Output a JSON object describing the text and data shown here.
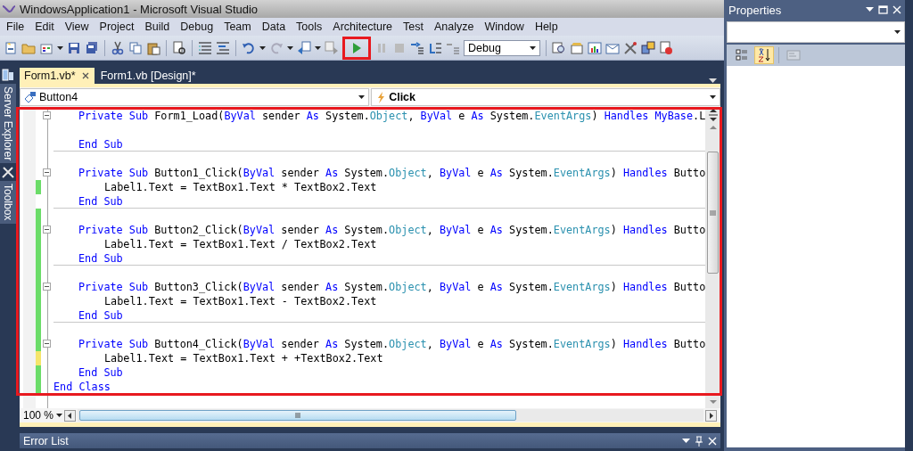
{
  "window": {
    "title": "WindowsApplication1 - Microsoft Visual Studio"
  },
  "menu": [
    "File",
    "Edit",
    "View",
    "Project",
    "Build",
    "Debug",
    "Team",
    "Data",
    "Tools",
    "Architecture",
    "Test",
    "Analyze",
    "Window",
    "Help"
  ],
  "toolbar": {
    "run_button": {
      "highlighted": true
    },
    "configuration": "Debug"
  },
  "sidebar": {
    "tabs": [
      "Server Explorer",
      "Toolbox"
    ]
  },
  "document_tabs": [
    {
      "label": "Form1.vb*",
      "selected": true
    },
    {
      "label": "Form1.vb [Design]*",
      "selected": false
    }
  ],
  "navigation": {
    "object": "Button4",
    "event": "Click"
  },
  "editor": {
    "highlighted": true,
    "zoom": "100 %",
    "lines": [
      {
        "kind": "member",
        "fold": true,
        "tokens": [
          {
            "kind": "keyword",
            "text": "Private Sub"
          },
          {
            "kind": "plain",
            "text": " Form1_Load("
          },
          {
            "kind": "keyword",
            "text": "ByVal"
          },
          {
            "kind": "plain",
            "text": " sender "
          },
          {
            "kind": "keyword",
            "text": "As"
          },
          {
            "kind": "plain",
            "text": " System."
          },
          {
            "kind": "type",
            "text": "Object"
          },
          {
            "kind": "plain",
            "text": ", "
          },
          {
            "kind": "keyword",
            "text": "ByVal"
          },
          {
            "kind": "plain",
            "text": " e "
          },
          {
            "kind": "keyword",
            "text": "As"
          },
          {
            "kind": "plain",
            "text": " System."
          },
          {
            "kind": "type",
            "text": "EventArgs"
          },
          {
            "kind": "plain",
            "text": ") "
          },
          {
            "kind": "keyword",
            "text": "Handles MyBase"
          },
          {
            "kind": "plain",
            "text": ".L"
          }
        ]
      },
      {
        "kind": "blank"
      },
      {
        "kind": "member",
        "separator": true,
        "tokens": [
          {
            "kind": "keyword",
            "text": "End Sub"
          }
        ]
      },
      {
        "kind": "blank"
      },
      {
        "kind": "member",
        "fold": true,
        "tokens": [
          {
            "kind": "keyword",
            "text": "Private Sub"
          },
          {
            "kind": "plain",
            "text": " Button1_Click("
          },
          {
            "kind": "keyword",
            "text": "ByVal"
          },
          {
            "kind": "plain",
            "text": " sender "
          },
          {
            "kind": "keyword",
            "text": "As"
          },
          {
            "kind": "plain",
            "text": " System."
          },
          {
            "kind": "type",
            "text": "Object"
          },
          {
            "kind": "plain",
            "text": ", "
          },
          {
            "kind": "keyword",
            "text": "ByVal"
          },
          {
            "kind": "plain",
            "text": " e "
          },
          {
            "kind": "keyword",
            "text": "As"
          },
          {
            "kind": "plain",
            "text": " System."
          },
          {
            "kind": "type",
            "text": "EventArgs"
          },
          {
            "kind": "plain",
            "text": ") "
          },
          {
            "kind": "keyword",
            "text": "Handles"
          },
          {
            "kind": "plain",
            "text": " Butto"
          }
        ]
      },
      {
        "kind": "body",
        "color": "#6bdc68",
        "tokens": [
          {
            "kind": "plain",
            "text": "Label1.Text = TextBox1.Text * TextBox2.Text"
          }
        ]
      },
      {
        "kind": "member",
        "separator": true,
        "tokens": [
          {
            "kind": "keyword",
            "text": "End Sub"
          }
        ]
      },
      {
        "kind": "blank",
        "color": "#6bdc68"
      },
      {
        "kind": "member",
        "fold": true,
        "color": "#6bdc68",
        "tokens": [
          {
            "kind": "keyword",
            "text": "Private Sub"
          },
          {
            "kind": "plain",
            "text": " Button2_Click("
          },
          {
            "kind": "keyword",
            "text": "ByVal"
          },
          {
            "kind": "plain",
            "text": " sender "
          },
          {
            "kind": "keyword",
            "text": "As"
          },
          {
            "kind": "plain",
            "text": " System."
          },
          {
            "kind": "type",
            "text": "Object"
          },
          {
            "kind": "plain",
            "text": ", "
          },
          {
            "kind": "keyword",
            "text": "ByVal"
          },
          {
            "kind": "plain",
            "text": " e "
          },
          {
            "kind": "keyword",
            "text": "As"
          },
          {
            "kind": "plain",
            "text": " System."
          },
          {
            "kind": "type",
            "text": "EventArgs"
          },
          {
            "kind": "plain",
            "text": ") "
          },
          {
            "kind": "keyword",
            "text": "Handles"
          },
          {
            "kind": "plain",
            "text": " Butto"
          }
        ]
      },
      {
        "kind": "body",
        "color": "#6bdc68",
        "tokens": [
          {
            "kind": "plain",
            "text": "Label1.Text = TextBox1.Text / TextBox2.Text"
          }
        ]
      },
      {
        "kind": "member",
        "separator": true,
        "color": "#6bdc68",
        "tokens": [
          {
            "kind": "keyword",
            "text": "End Sub"
          }
        ]
      },
      {
        "kind": "blank",
        "color": "#6bdc68"
      },
      {
        "kind": "member",
        "fold": true,
        "color": "#6bdc68",
        "tokens": [
          {
            "kind": "keyword",
            "text": "Private Sub"
          },
          {
            "kind": "plain",
            "text": " Button3_Click("
          },
          {
            "kind": "keyword",
            "text": "ByVal"
          },
          {
            "kind": "plain",
            "text": " sender "
          },
          {
            "kind": "keyword",
            "text": "As"
          },
          {
            "kind": "plain",
            "text": " System."
          },
          {
            "kind": "type",
            "text": "Object"
          },
          {
            "kind": "plain",
            "text": ", "
          },
          {
            "kind": "keyword",
            "text": "ByVal"
          },
          {
            "kind": "plain",
            "text": " e "
          },
          {
            "kind": "keyword",
            "text": "As"
          },
          {
            "kind": "plain",
            "text": " System."
          },
          {
            "kind": "type",
            "text": "EventArgs"
          },
          {
            "kind": "plain",
            "text": ") "
          },
          {
            "kind": "keyword",
            "text": "Handles"
          },
          {
            "kind": "plain",
            "text": " Butto"
          }
        ]
      },
      {
        "kind": "body",
        "color": "#6bdc68",
        "tokens": [
          {
            "kind": "plain",
            "text": "Label1.Text = TextBox1.Text - TextBox2.Text"
          }
        ]
      },
      {
        "kind": "member",
        "separator": true,
        "color": "#6bdc68",
        "tokens": [
          {
            "kind": "keyword",
            "text": "End Sub"
          }
        ]
      },
      {
        "kind": "blank",
        "color": "#6bdc68"
      },
      {
        "kind": "member",
        "fold": true,
        "color": "#6bdc68",
        "tokens": [
          {
            "kind": "keyword",
            "text": "Private Sub"
          },
          {
            "kind": "plain",
            "text": " Button4_Click("
          },
          {
            "kind": "keyword",
            "text": "ByVal"
          },
          {
            "kind": "plain",
            "text": " sender "
          },
          {
            "kind": "keyword",
            "text": "As"
          },
          {
            "kind": "plain",
            "text": " System."
          },
          {
            "kind": "type",
            "text": "Object"
          },
          {
            "kind": "plain",
            "text": ", "
          },
          {
            "kind": "keyword",
            "text": "ByVal"
          },
          {
            "kind": "plain",
            "text": " e "
          },
          {
            "kind": "keyword",
            "text": "As"
          },
          {
            "kind": "plain",
            "text": " System."
          },
          {
            "kind": "type",
            "text": "EventArgs"
          },
          {
            "kind": "plain",
            "text": ") "
          },
          {
            "kind": "keyword",
            "text": "Handles"
          },
          {
            "kind": "plain",
            "text": " Butto"
          }
        ]
      },
      {
        "kind": "body",
        "color": "#f5e56b",
        "tokens": [
          {
            "kind": "plain",
            "text": "Label1.Text = TextBox1.Text + +TextBox2.Text"
          }
        ]
      },
      {
        "kind": "member",
        "color": "#6bdc68",
        "tokens": [
          {
            "kind": "keyword",
            "text": "End Sub"
          }
        ]
      },
      {
        "kind": "class",
        "color": "#6bdc68",
        "tokens": [
          {
            "kind": "keyword",
            "text": "End Class"
          }
        ]
      }
    ]
  },
  "error_list": {
    "title": "Error List"
  },
  "properties": {
    "title": "Properties",
    "sort_buttons": [
      {
        "kind": "categorized",
        "selected": false
      },
      {
        "kind": "alphabetical",
        "selected": true
      }
    ],
    "pages_button": {
      "disabled": true
    }
  }
}
